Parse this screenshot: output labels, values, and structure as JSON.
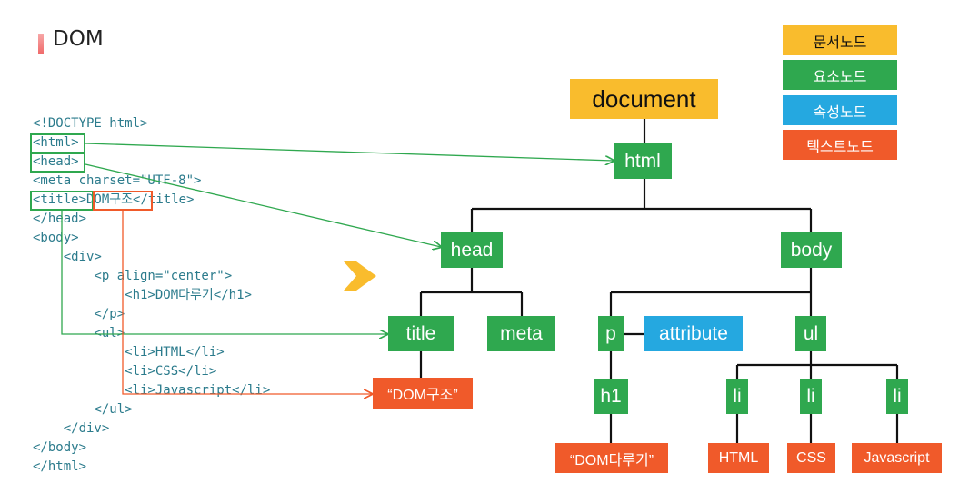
{
  "title": "DOM",
  "code_lines": [
    "<!DOCTYPE html>",
    "<html>",
    "<head>",
    "<meta charset=\"UTF-8\">",
    "<title>DOM구조</title>",
    "</head>",
    "<body>",
    "    <div>",
    "        <p align=\"center\">",
    "            <h1>DOM다루기</h1>",
    "        </p>",
    "        <ul>",
    "            <li>HTML</li>",
    "            <li>CSS</li>",
    "            <li>Javascript</li>",
    "        </ul>",
    "    </div>",
    "</body>",
    "</html>"
  ],
  "legend": [
    {
      "label": "문서노드",
      "color": "#f9bc2d",
      "text_color": "#111111"
    },
    {
      "label": "요소노드",
      "color": "#2fa84f",
      "text_color": "#ffffff"
    },
    {
      "label": "속성노드",
      "color": "#25a8e0",
      "text_color": "#ffffff"
    },
    {
      "label": "텍스트노드",
      "color": "#f05a2a",
      "text_color": "#ffffff"
    }
  ],
  "nodes": {
    "document": "document",
    "html": "html",
    "head": "head",
    "body": "body",
    "title": "title",
    "meta": "meta",
    "p": "p",
    "attribute": "attribute",
    "ul": "ul",
    "h1": "h1",
    "li1": "li",
    "li2": "li",
    "li3": "li",
    "text_title": "“DOM구조”",
    "text_h1": "“DOM다루기”",
    "text_html": "HTML",
    "text_css": "CSS",
    "text_js": "Javascript"
  },
  "colors": {
    "document": "#f9bc2d",
    "element": "#2fa84f",
    "attribute": "#25a8e0",
    "text": "#f05a2a",
    "arrow_head": "#f9bc2d"
  }
}
